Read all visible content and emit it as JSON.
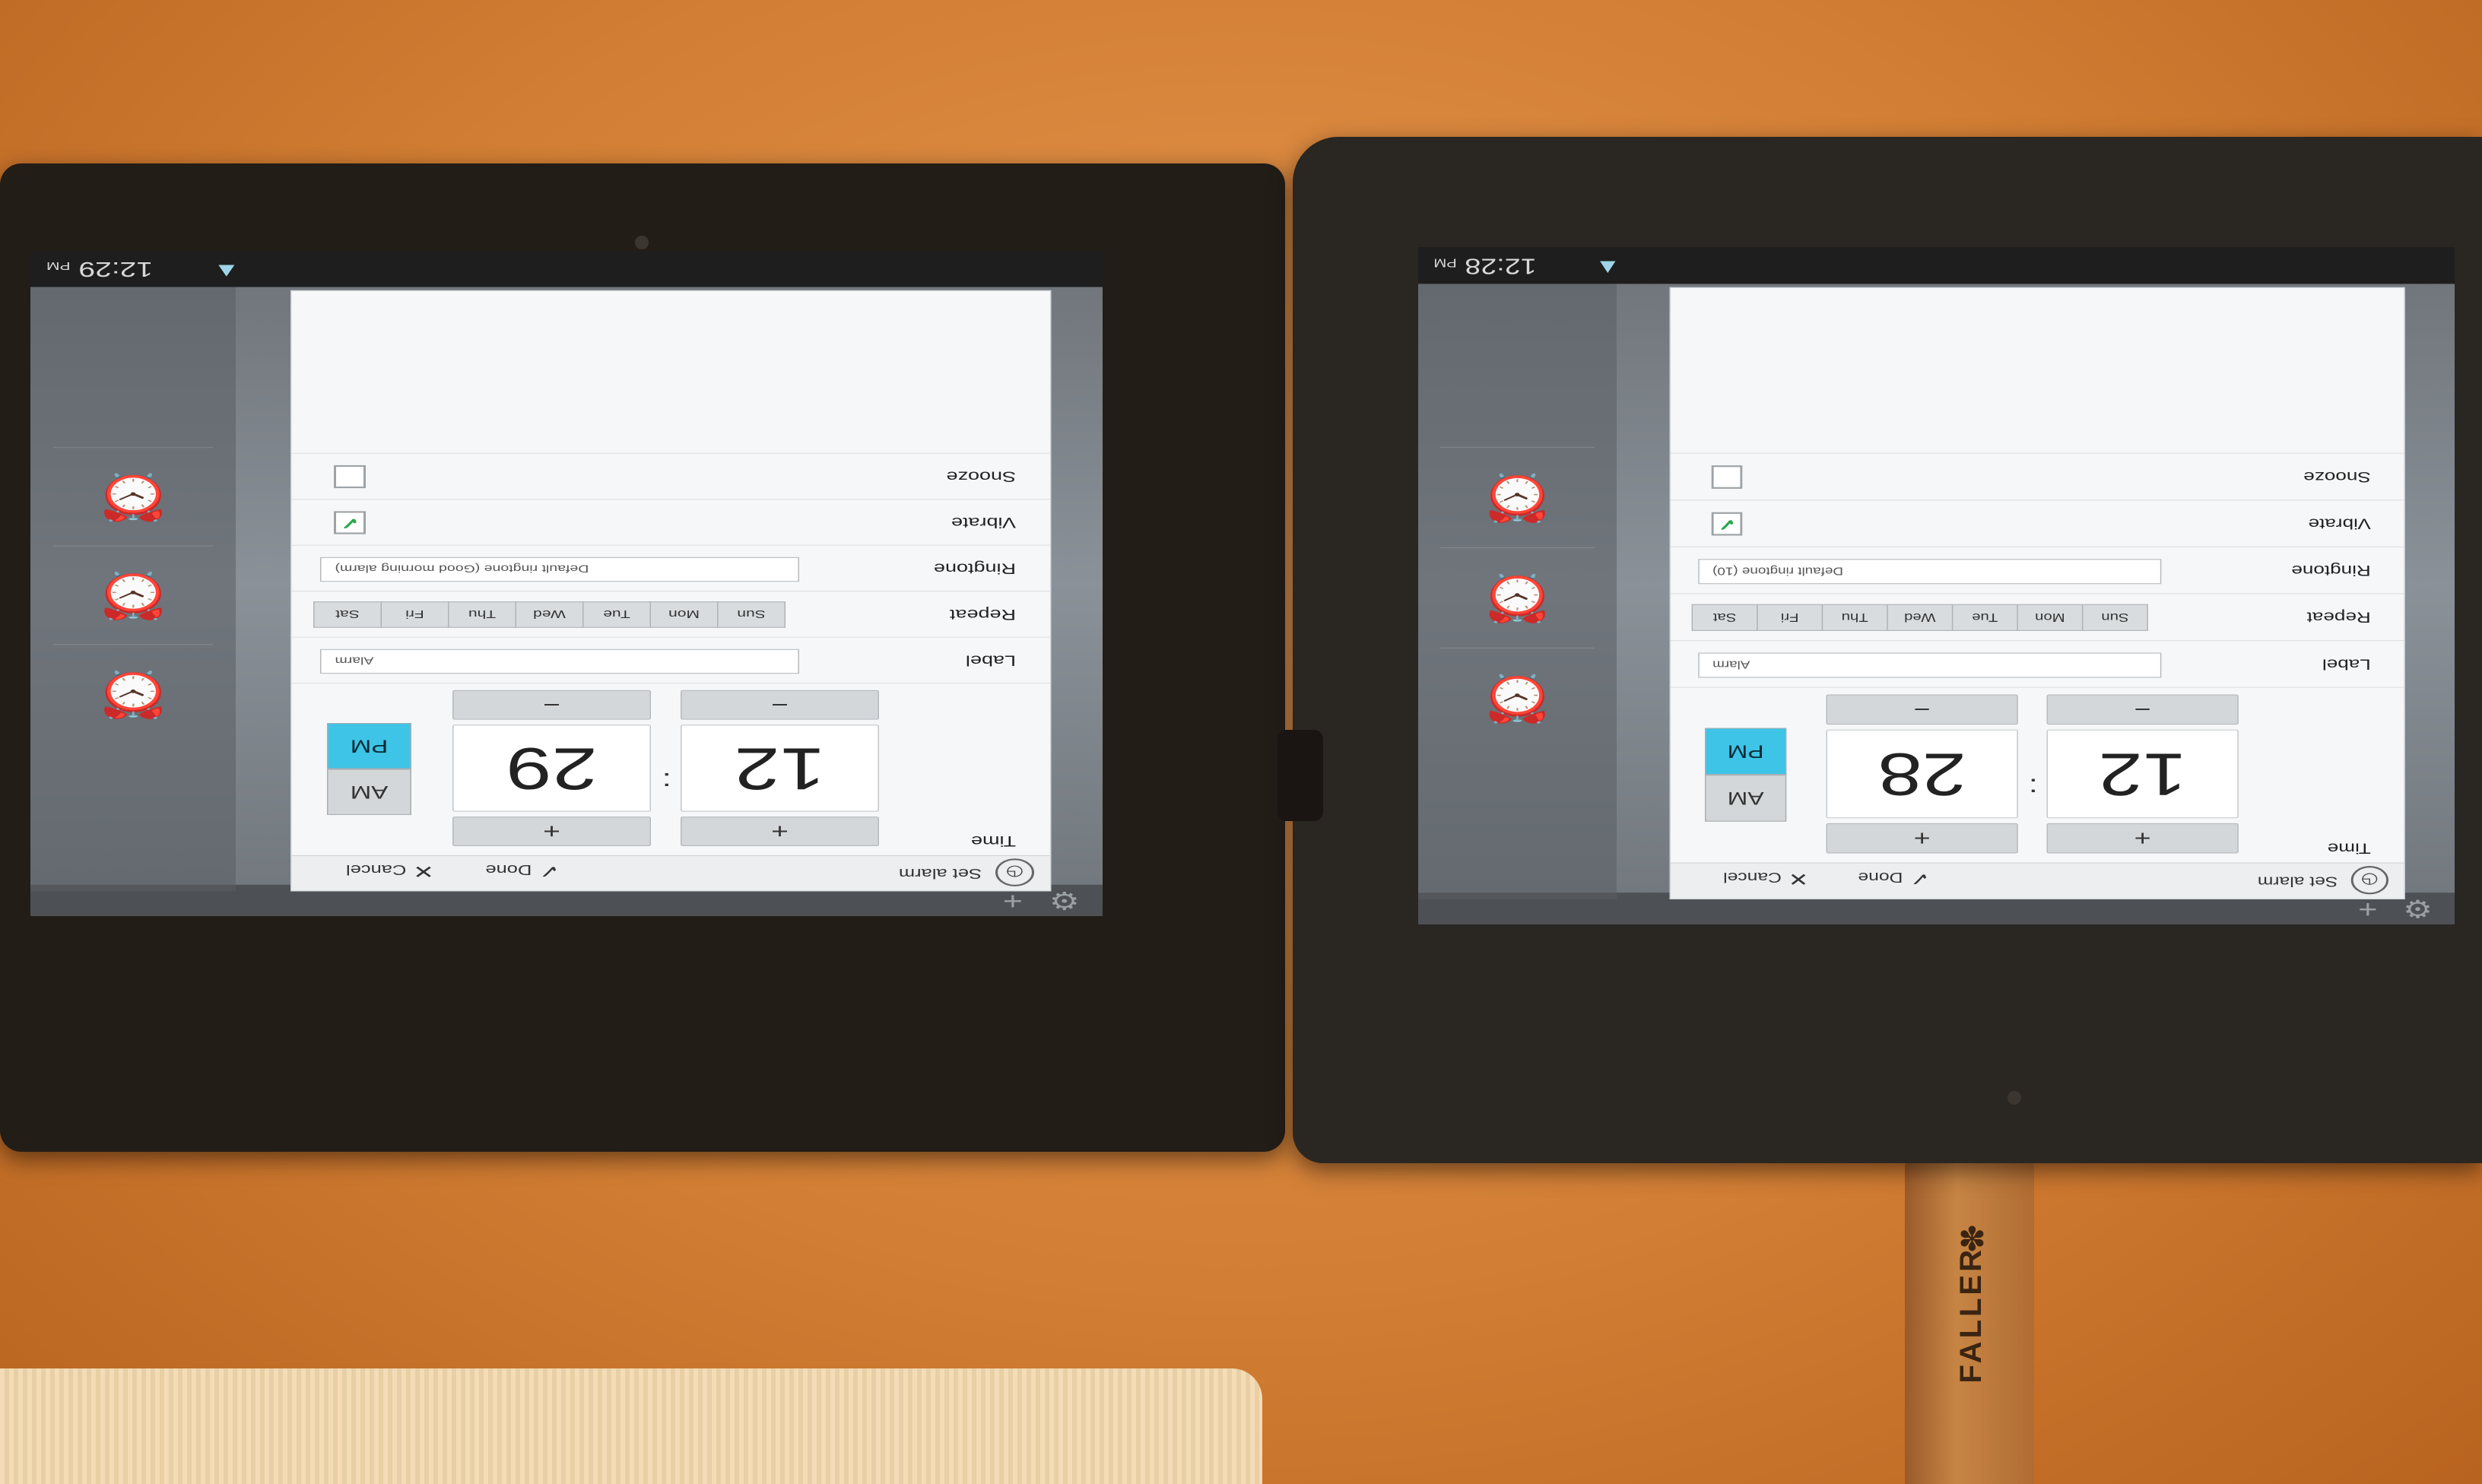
{
  "devices": [
    {
      "status_time": "12:29",
      "status_ampm": "PM",
      "dialog": {
        "title": "Set alarm",
        "done": "Done",
        "cancel": "Cancel",
        "time_label": "Time",
        "hour": "12",
        "minute": "29",
        "am": "AM",
        "pm": "PM",
        "plus": "+",
        "minus": "−",
        "label_label": "Label",
        "label_value": "Alarm",
        "repeat_label": "Repeat",
        "days": [
          "Sun",
          "Mon",
          "Tue",
          "Wed",
          "Thu",
          "Fri",
          "Sat"
        ],
        "ringtone_label": "Ringtone",
        "ringtone_value": "Default ringtone (Good morning alarm)",
        "vibrate_label": "Vibrate",
        "vibrate_checked": true,
        "snooze_label": "Snooze",
        "snooze_checked": false
      }
    },
    {
      "status_time": "12:28",
      "status_ampm": "PM",
      "dialog": {
        "title": "Set alarm",
        "done": "Done",
        "cancel": "Cancel",
        "time_label": "Time",
        "hour": "12",
        "minute": "28",
        "am": "AM",
        "pm": "PM",
        "plus": "+",
        "minus": "−",
        "label_label": "Label",
        "label_value": "Alarm",
        "repeat_label": "Repeat",
        "days": [
          "Sun",
          "Mon",
          "Tue",
          "Wed",
          "Thu",
          "Fri",
          "Sat"
        ],
        "ringtone_label": "Ringtone",
        "ringtone_value": "Default ringtone (10)",
        "vibrate_label": "Vibrate",
        "vibrate_checked": true,
        "snooze_label": "Snooze",
        "snooze_checked": false
      }
    }
  ],
  "usb_label": "FALLER"
}
